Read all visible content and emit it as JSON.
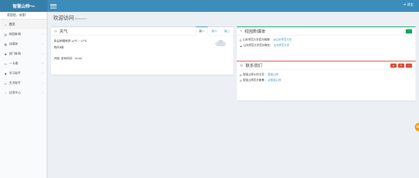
{
  "logo": {
    "text": "智慧山师",
    "sup": "Plus"
  },
  "topbar": {
    "logout_label": "退出"
  },
  "sidebar": {
    "welcome": "欢迎您，访客！",
    "items": [
      {
        "label": "首页",
        "icon": "home-icon",
        "glyph": "⌂",
        "active": true,
        "caret": false
      },
      {
        "label": "校园新闻",
        "icon": "news-icon",
        "glyph": "▤",
        "active": false,
        "caret": true
      },
      {
        "label": "自媒体",
        "icon": "media-icon",
        "glyph": "▦",
        "active": false,
        "caret": true
      },
      {
        "label": "部门新闻",
        "icon": "rss-icon",
        "glyph": "◉",
        "active": false,
        "caret": true
      },
      {
        "label": "一卡通",
        "icon": "card-icon",
        "glyph": "▭",
        "active": false,
        "caret": true
      },
      {
        "label": "学习助手",
        "icon": "graduation-cap-icon",
        "glyph": "◆",
        "active": false,
        "caret": true
      },
      {
        "label": "生活助手",
        "icon": "coffee-icon",
        "glyph": "☕",
        "active": false,
        "caret": true
      },
      {
        "label": "应用中心",
        "icon": "pie-chart-icon",
        "glyph": "◔",
        "active": false,
        "caret": true
      }
    ]
  },
  "content": {
    "title": "欢迎访问",
    "subtitle": "Welcome"
  },
  "weather": {
    "title": "天气",
    "tabs": [
      {
        "label": "周一",
        "active": true
      },
      {
        "label": "周二",
        "active": false
      },
      {
        "label": "周三",
        "active": false
      }
    ],
    "condition": "多云转晴转阴 14℃ ~ 27℃",
    "wind": "南风3级",
    "publish": "济南, 发布时间：00:00"
  },
  "media": {
    "title": "校园新媒体",
    "lines": [
      {
        "icon": "weibo-icon",
        "prefix": "山东师范大学官方微博：",
        "link": "@山东师范大学"
      },
      {
        "icon": "wechat-icon",
        "prefix": "山东师范大学官方微信：",
        "link": "山东师范大学"
      }
    ]
  },
  "contact": {
    "title": "联系我们",
    "lines": [
      {
        "icon": "weibo-icon",
        "prefix": "智慧山师公共主页：",
        "link": "智慧山师"
      },
      {
        "icon": "weibo-icon",
        "prefix": "智慧山师官方微博：",
        "link": "@智慧山师"
      }
    ]
  },
  "colors": {
    "header": "#3c8dbc",
    "logo_bg": "#367fa9",
    "green": "#00a65a",
    "red": "#dd4b39",
    "orange": "#f39c12"
  }
}
